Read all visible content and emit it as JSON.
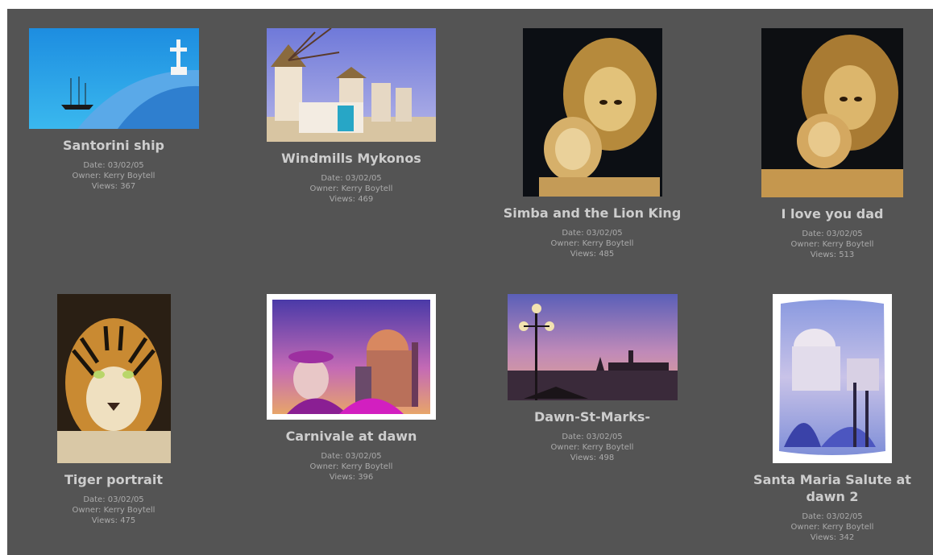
{
  "gallery": {
    "items": [
      {
        "title": "Santorini ship",
        "date": "Date: 03/02/05",
        "owner": "Owner: Kerry Boytell",
        "views": "Views: 367"
      },
      {
        "title": "Windmills Mykonos",
        "date": "Date: 03/02/05",
        "owner": "Owner: Kerry Boytell",
        "views": "Views: 469"
      },
      {
        "title": "Simba and the Lion King",
        "date": "Date: 03/02/05",
        "owner": "Owner: Kerry Boytell",
        "views": "Views: 485"
      },
      {
        "title": "I love you dad",
        "date": "Date: 03/02/05",
        "owner": "Owner: Kerry Boytell",
        "views": "Views: 513"
      },
      {
        "title": "Tiger portrait",
        "date": "Date: 03/02/05",
        "owner": "Owner: Kerry Boytell",
        "views": "Views: 475"
      },
      {
        "title": "Carnivale at dawn",
        "date": "Date: 03/02/05",
        "owner": "Owner: Kerry Boytell",
        "views": "Views: 396"
      },
      {
        "title": "Dawn-St-Marks-",
        "date": "Date: 03/02/05",
        "owner": "Owner: Kerry Boytell",
        "views": "Views: 498"
      },
      {
        "title": "Santa Maria Salute at dawn 2",
        "date": "Date: 03/02/05",
        "owner": "Owner: Kerry Boytell",
        "views": "Views: 342"
      }
    ]
  }
}
